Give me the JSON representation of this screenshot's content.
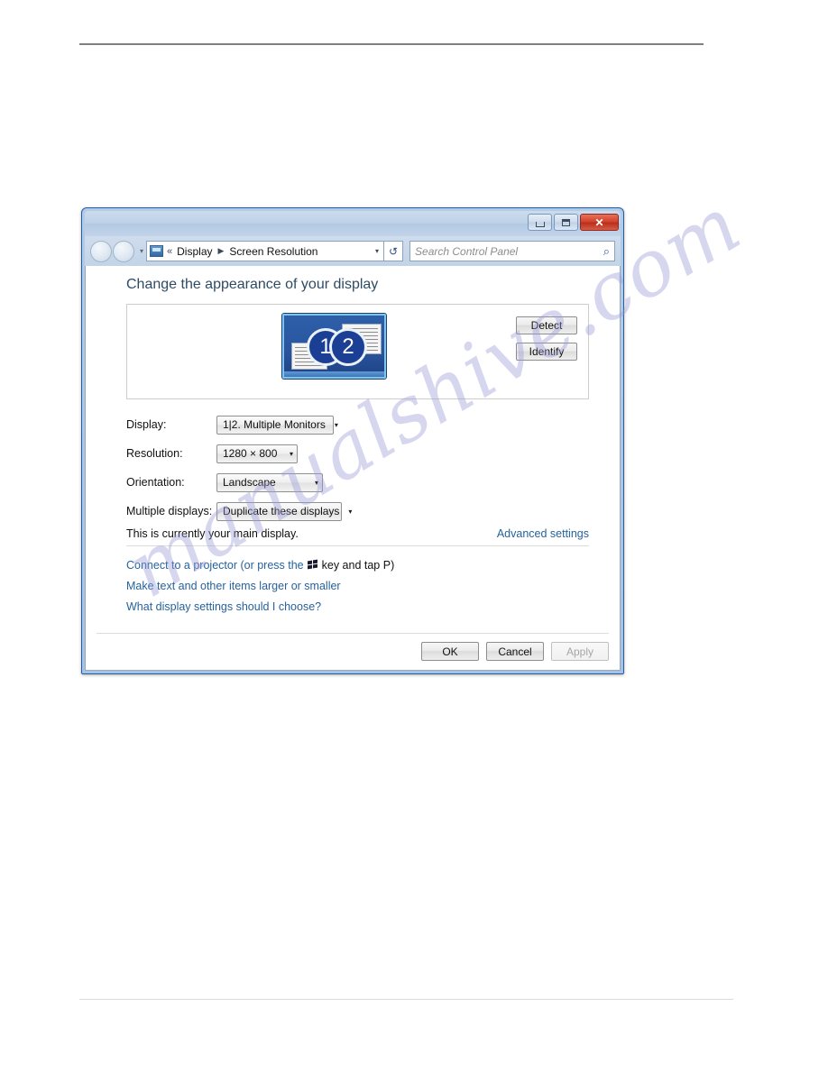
{
  "window": {
    "controls": {
      "minimize_label": "minimize",
      "maximize_label": "maximize",
      "close_label": "✕"
    },
    "nav": {
      "chevrons": "«",
      "breadcrumb_1": "Display",
      "breadcrumb_separator": "▶",
      "breadcrumb_2": "Screen Resolution",
      "dropdown_caret": "▾",
      "address_caret": "▾",
      "refresh_glyph": "↺"
    },
    "search": {
      "placeholder": "Search Control Panel",
      "icon": "⌕"
    }
  },
  "content": {
    "heading": "Change the appearance of your display",
    "preview": {
      "monitor_1_label": "1",
      "monitor_2_label": "2",
      "detect_button": "Detect",
      "identify_button": "Identify"
    },
    "form": {
      "display": {
        "label": "Display:",
        "value": "1|2. Multiple Monitors",
        "caret": "▾"
      },
      "resolution": {
        "label": "Resolution:",
        "value": "1280 × 800",
        "caret": "▾"
      },
      "orientation": {
        "label": "Orientation:",
        "value": "Landscape",
        "caret": "▾"
      },
      "multiple_displays": {
        "label": "Multiple displays:",
        "value": "Duplicate these displays",
        "caret": "▾"
      }
    },
    "main_display_note": "This is currently your main display.",
    "advanced_settings_link": "Advanced settings",
    "links": {
      "projector_prefix": "Connect to a projector (or press the",
      "projector_suffix": "key and tap P)",
      "make_text_larger": "Make text and other items larger or smaller",
      "what_settings": "What display settings should I choose?"
    },
    "footer": {
      "ok": "OK",
      "cancel": "Cancel",
      "apply": "Apply"
    }
  },
  "watermark": {
    "text": "manualshive.com"
  }
}
